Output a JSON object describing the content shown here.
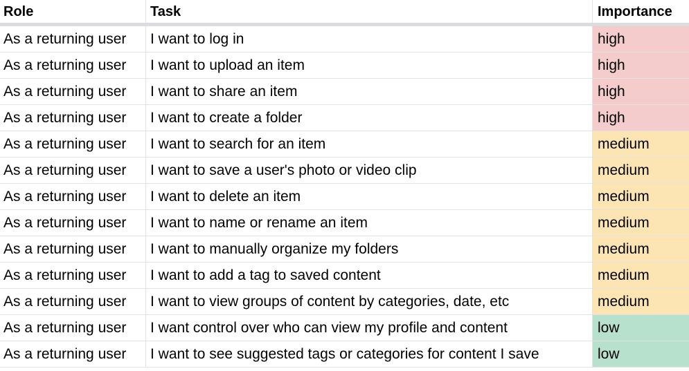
{
  "headers": {
    "role": "Role",
    "task": "Task",
    "importance": "Importance"
  },
  "colors": {
    "high": "#f4cccc",
    "medium": "#fce5b3",
    "low": "#b7e1cd"
  },
  "rows": [
    {
      "role": "As a returning user",
      "task": "I want to log in",
      "importance": "high",
      "level": "high"
    },
    {
      "role": "As a returning user",
      "task": "I want to upload an item",
      "importance": "high",
      "level": "high"
    },
    {
      "role": "As a returning user",
      "task": "I want to share an item",
      "importance": "high",
      "level": "high"
    },
    {
      "role": "As a returning user",
      "task": "I want to create a folder",
      "importance": "high",
      "level": "high"
    },
    {
      "role": "As a returning user",
      "task": "I want to search for an item",
      "importance": "medium",
      "level": "medium"
    },
    {
      "role": "As a returning user",
      "task": "I want to save a user's photo or video clip",
      "importance": "medium",
      "level": "medium"
    },
    {
      "role": "As a returning user",
      "task": "I want to delete an item",
      "importance": "medium",
      "level": "medium"
    },
    {
      "role": "As a returning user",
      "task": "I want to name or rename an item",
      "importance": "medium",
      "level": "medium"
    },
    {
      "role": "As a returning user",
      "task": "I want to manually organize my folders",
      "importance": "medium",
      "level": "medium"
    },
    {
      "role": "As a returning user",
      "task": "I want to add a tag to saved content",
      "importance": "medium",
      "level": "medium"
    },
    {
      "role": "As a returning user",
      "task": "I want to view groups of content by categories, date, etc",
      "importance": "medium",
      "level": "medium"
    },
    {
      "role": "As a returning user",
      "task": "I want control over who can view my profile and content",
      "importance": "low",
      "level": "low"
    },
    {
      "role": "As a returning user",
      "task": "I want to see suggested tags or categories for content I save",
      "importance": "low",
      "level": "low"
    }
  ]
}
